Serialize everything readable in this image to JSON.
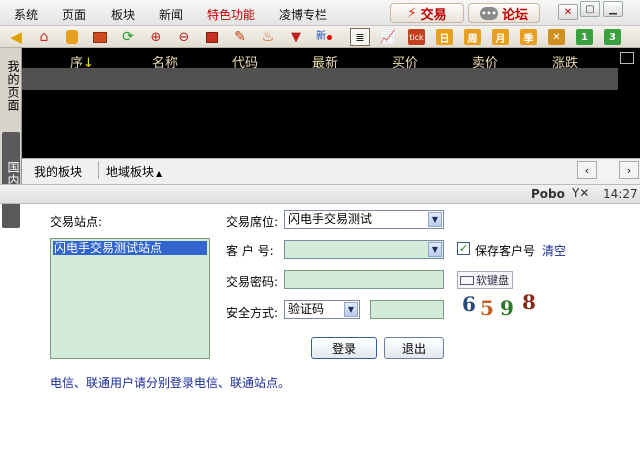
{
  "menu": {
    "items": [
      "系统",
      "页面",
      "板块",
      "新闻",
      "特色功能",
      "凌博专栏"
    ]
  },
  "top_buttons": {
    "trade": "交易",
    "forum": "论坛"
  },
  "toolbar": {
    "new_label": "新",
    "tick_label": "tick",
    "day": "日",
    "week": "周",
    "month": "月",
    "season": "季",
    "num1": "1",
    "num3": "3"
  },
  "side_tabs": {
    "my_page": "我的页面",
    "domestic": "国内期"
  },
  "grid": {
    "columns": [
      "序",
      "名称",
      "代码",
      "最新",
      "买价",
      "卖价",
      "涨跌"
    ],
    "sort_arrow": "↓"
  },
  "tabs": {
    "my_sector": "我的板块",
    "region_sector": "地域板块",
    "region_arrow": "▲"
  },
  "status": {
    "brand": "Pobo",
    "time": "14:27"
  },
  "login": {
    "station_label": "交易站点:",
    "stations": [
      "闪电手交易测试站点"
    ],
    "seat_label": "交易席位:",
    "seat_value": "闪电手交易测试",
    "account_label": "客 户 号:",
    "account_value": "",
    "save_account_label": "保存客户号",
    "save_account_checked": true,
    "clear_label": "清空",
    "password_label": "交易密码:",
    "password_value": "",
    "soft_keyboard_label": "软键盘",
    "security_label": "安全方式:",
    "security_value": "验证码",
    "captcha_input_value": "",
    "captcha_digits": [
      "6",
      "5",
      "9",
      "8"
    ],
    "login_button": "登录",
    "exit_button": "退出",
    "notice": "电信、联通用户请分别登录电信、联通站点。"
  },
  "colors": {
    "grid_bg": "#000000",
    "grid_header_text": "#eadcb0",
    "field_bg": "#d3ecd7",
    "notice_text": "#1a2a9a",
    "special_menu": "#c00000"
  }
}
